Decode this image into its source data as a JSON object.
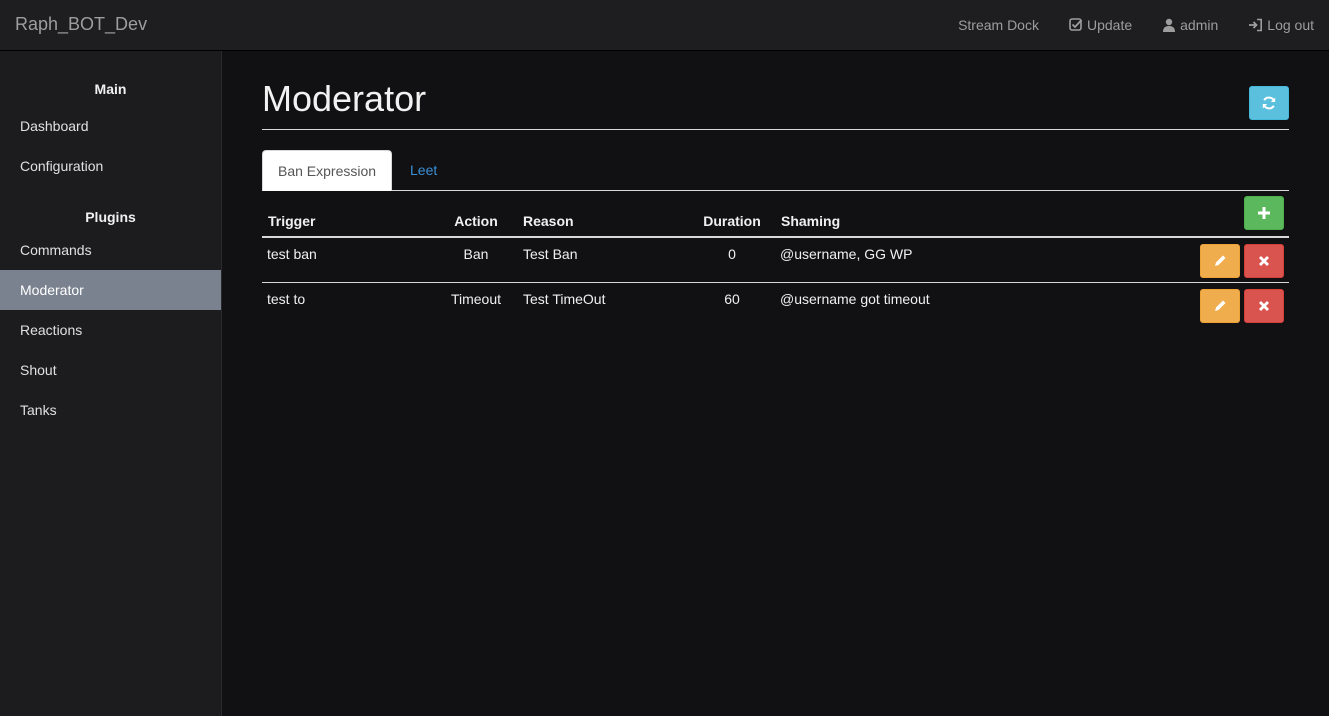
{
  "navbar": {
    "brand": "Raph_BOT_Dev",
    "links": [
      {
        "label": "Stream Dock",
        "icon": ""
      },
      {
        "label": "Update",
        "icon": "check-square-icon"
      },
      {
        "label": "admin",
        "icon": "user-icon"
      },
      {
        "label": "Log out",
        "icon": "log-out-icon"
      }
    ]
  },
  "sidebar": {
    "sections": [
      {
        "header": "Main",
        "items": [
          "Dashboard",
          "Configuration"
        ]
      },
      {
        "header": "Plugins",
        "items": [
          "Commands",
          "Moderator",
          "Reactions",
          "Shout",
          "Tanks"
        ]
      }
    ],
    "active": "Moderator"
  },
  "page": {
    "title": "Moderator",
    "tabs": [
      {
        "label": "Ban Expression",
        "active": true
      },
      {
        "label": "Leet",
        "active": false
      }
    ]
  },
  "table": {
    "headers": {
      "trigger": "Trigger",
      "action": "Action",
      "reason": "Reason",
      "duration": "Duration",
      "shaming": "Shaming"
    },
    "rows": [
      {
        "trigger": "test ban",
        "action": "Ban",
        "reason": "Test Ban",
        "duration": "0",
        "shaming": "@username, GG WP"
      },
      {
        "trigger": "test to",
        "action": "Timeout",
        "reason": "Test TimeOut",
        "duration": "60",
        "shaming": "@username got timeout"
      }
    ]
  },
  "colors": {
    "refresh": "#5bc0de",
    "add": "#5cb85c",
    "edit": "#f0ad4e",
    "delete": "#d9534f",
    "active_sidebar": "#7a828f",
    "tab_link": "#3a8fd6"
  }
}
